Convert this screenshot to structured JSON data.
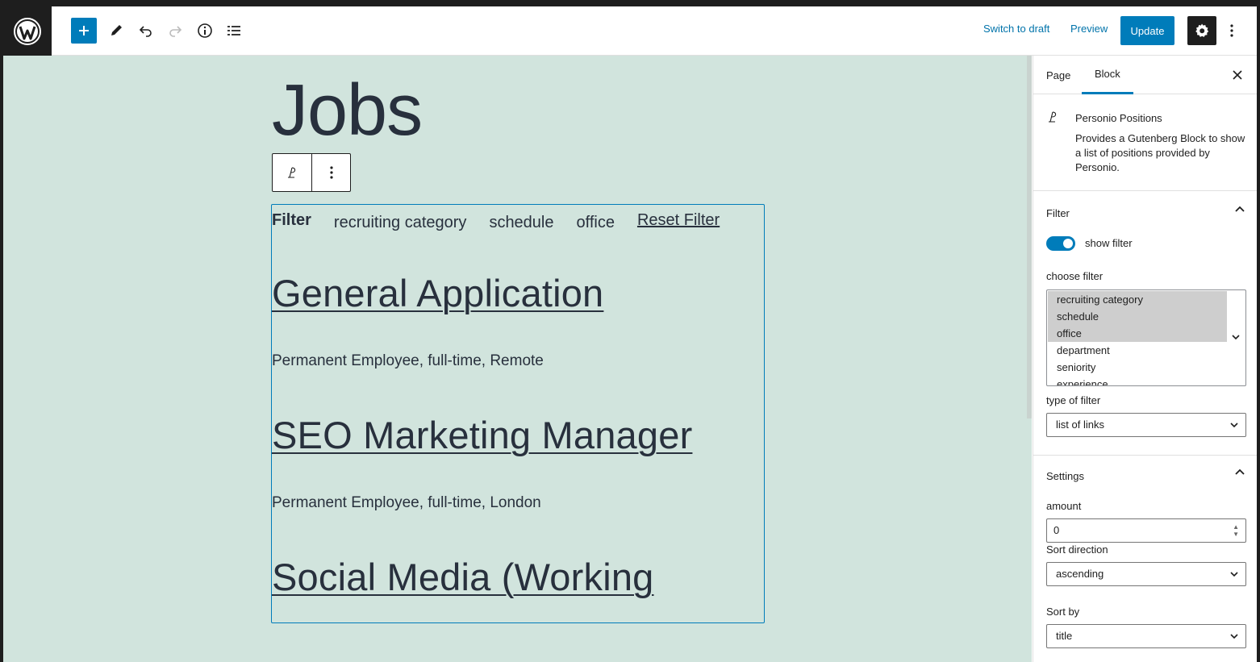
{
  "topbar": {
    "switch_to_draft": "Switch to draft",
    "preview": "Preview",
    "update": "Update"
  },
  "editor": {
    "page_title": "Jobs",
    "filter": {
      "label": "Filter",
      "items": [
        "recruiting category",
        "schedule",
        "office"
      ],
      "reset": "Reset Filter"
    },
    "jobs": [
      {
        "title": "General Application",
        "meta": "Permanent Employee, full-time, Remote"
      },
      {
        "title": "SEO Marketing Manager",
        "meta": "Permanent Employee, full-time, London"
      },
      {
        "title": "Social Media (Working",
        "meta": ""
      }
    ]
  },
  "sidebar": {
    "tabs": {
      "page": "Page",
      "block": "Block"
    },
    "block_card": {
      "title": "Personio Positions",
      "description": "Provides a Gutenberg Block to show a list of positions provided by Personio."
    },
    "filter_panel": {
      "title": "Filter",
      "show_filter_label": "show filter",
      "show_filter": true,
      "choose_filter_label": "choose filter",
      "options": [
        {
          "label": "recruiting category",
          "selected": true
        },
        {
          "label": "schedule",
          "selected": true
        },
        {
          "label": "office",
          "selected": true
        },
        {
          "label": "department",
          "selected": false
        },
        {
          "label": "seniority",
          "selected": false
        },
        {
          "label": "experience",
          "selected": false
        }
      ],
      "type_label": "type of filter",
      "type_value": "list of links"
    },
    "settings_panel": {
      "title": "Settings",
      "amount_label": "amount",
      "amount_value": "0",
      "sort_direction_label": "Sort direction",
      "sort_direction_value": "ascending",
      "sort_by_label": "Sort by",
      "sort_by_value": "title"
    }
  },
  "colors": {
    "accent": "#007cba",
    "canvas_bg": "#d1e4dd",
    "text": "#28303d"
  }
}
